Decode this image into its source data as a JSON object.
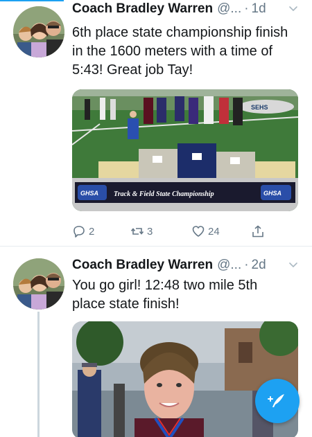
{
  "colors": {
    "accent": "#1da1f2",
    "secondary_text": "#657786",
    "primary_text": "#14171a",
    "divider": "#e6ecf0"
  },
  "tweets": [
    {
      "author": "Coach Bradley Warren",
      "handle": "@...",
      "separator": "·",
      "time": "1d",
      "text": "6th place state championship finish in the 1600 meters with a time of 5:43! Great job Tay!",
      "media": {
        "banner_logo_left": "GHSA",
        "banner_text": "Track & Field State Championship",
        "banner_logo_right": "GHSA"
      },
      "actions": {
        "reply_icon": "reply-icon",
        "reply_count": "2",
        "retweet_icon": "retweet-icon",
        "retweet_count": "3",
        "like_icon": "heart-icon",
        "like_count": "24",
        "share_icon": "share-icon"
      }
    },
    {
      "author": "Coach Bradley Warren",
      "handle": "@...",
      "separator": "·",
      "time": "2d",
      "text": "You go girl! 12:48 two mile 5th place state finish!"
    }
  ],
  "fab": {
    "icon": "compose-icon"
  }
}
